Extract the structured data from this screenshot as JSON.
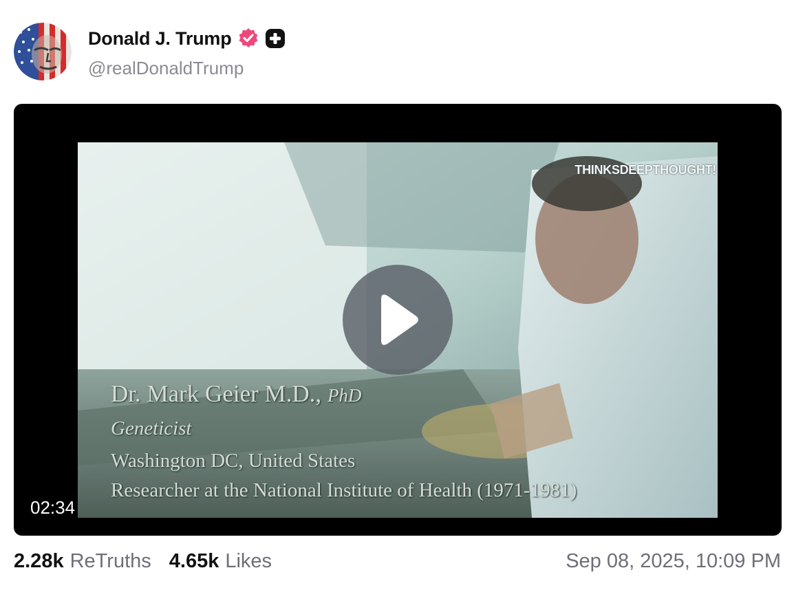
{
  "post": {
    "author": {
      "display_name": "Donald J. Trump",
      "handle": "@realDonaldTrump",
      "avatar_icon": "flag-face-avatar-icon",
      "verified_icon": "verified-badge-icon",
      "verified_color": "#f0477a",
      "plus_icon": "plus-badge-icon"
    },
    "video": {
      "duration": "02:34",
      "play_icon": "play-icon",
      "watermark": "THINKSDEEPTHOUGHT!",
      "caption": {
        "name": "Dr. Mark Geier M.D.,",
        "degree": "PhD",
        "role": "Geneticist",
        "location": "Washington DC, United States",
        "researcher": "Researcher at the National Institute of Health (1971-1981)"
      }
    },
    "stats": {
      "retruths_count": "2.28k",
      "retruths_label": "ReTruths",
      "likes_count": "4.65k",
      "likes_label": "Likes"
    },
    "timestamp": "Sep 08, 2025, 10:09 PM"
  }
}
